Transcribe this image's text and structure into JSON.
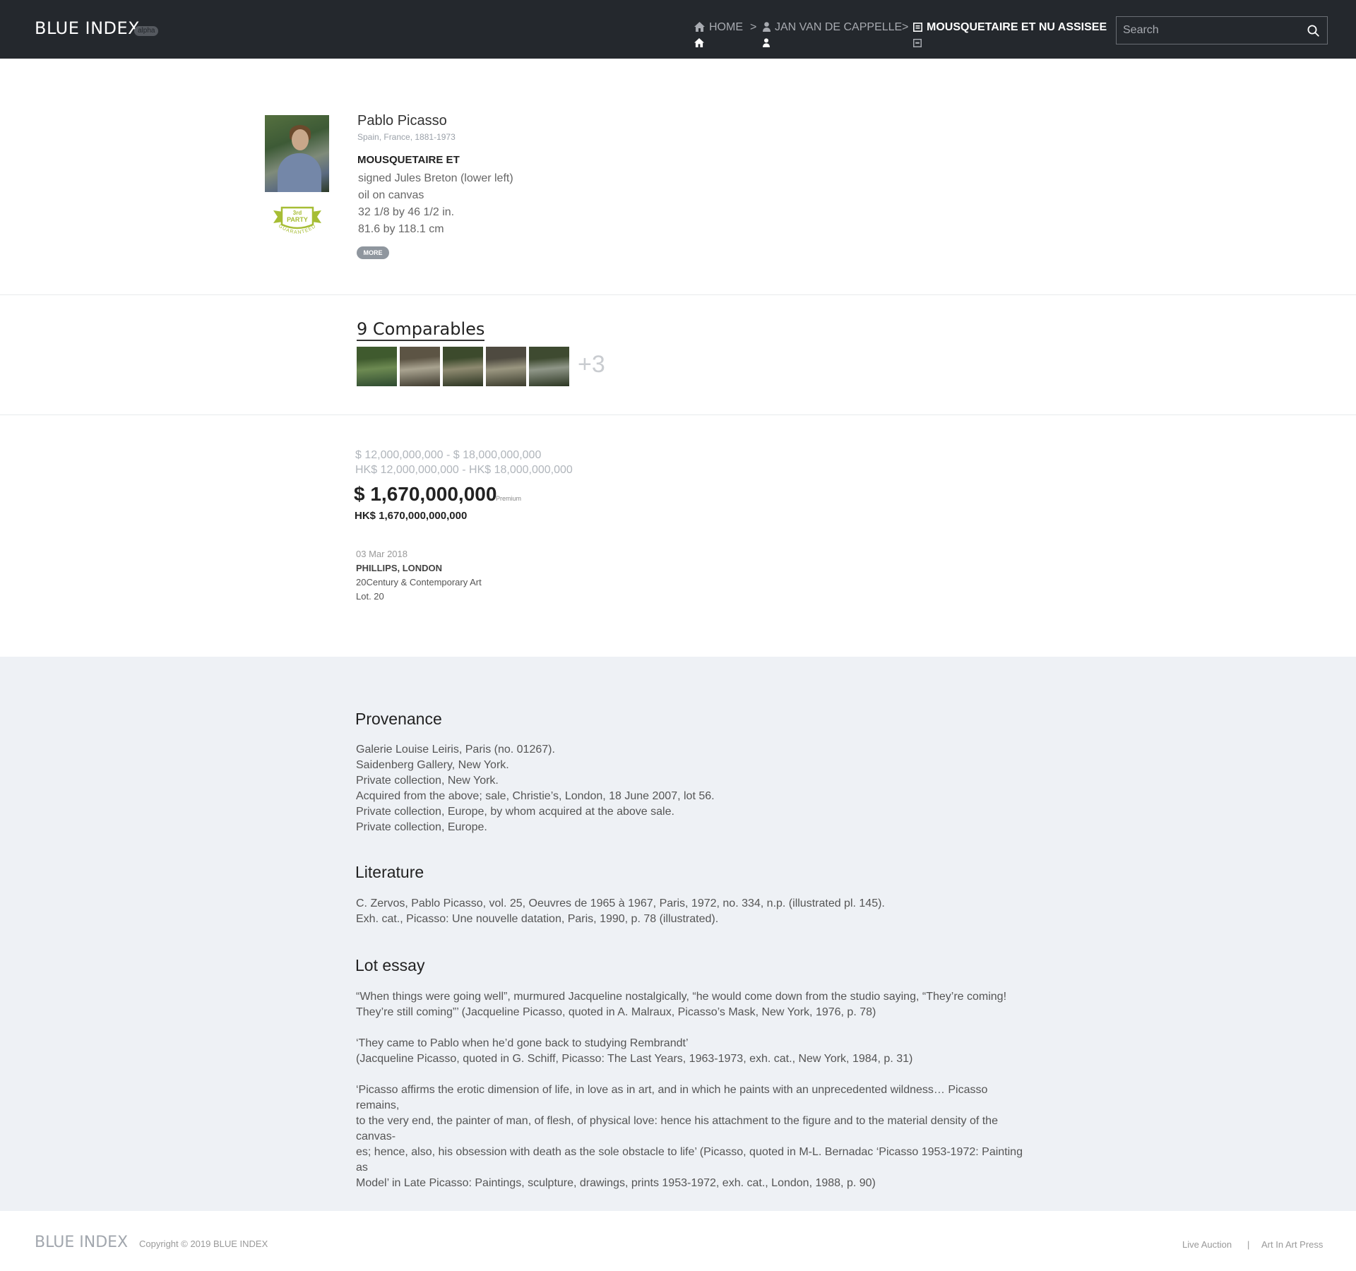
{
  "header": {
    "logo": "BLUE INDEX",
    "badge": "alpha",
    "breadcrumbs": [
      {
        "label": "HOME",
        "icon": "home-icon"
      },
      {
        "label": "JAN VAN DE CAPPELLE",
        "icon": "person-icon"
      },
      {
        "label": "MOUSQUETAIRE ET NU ASSISEE",
        "icon": "artwork-icon"
      }
    ],
    "separator": ">",
    "search_placeholder": "Search"
  },
  "artwork": {
    "artist": "Pablo Picasso",
    "lifespan": "Spain, France, 1881-1973",
    "title": "MOUSQUETAIRE ET",
    "details": [
      "signed Jules Breton (lower left)",
      "oil on canvas",
      "32 1/8 by 46 1/2 in.",
      "81.6 by 118.1 cm"
    ],
    "more_label": "MORE",
    "seal": {
      "top": "3rd",
      "middle": "PARTY",
      "bottom": "GUARANTEED",
      "color": "#a6bd34"
    }
  },
  "comparables": {
    "heading": "9 Comparables",
    "more": "+3",
    "thumbs": [
      {
        "colors": [
          "#3f5a2e",
          "#6d8a52",
          "#2e4a30"
        ]
      },
      {
        "colors": [
          "#5c5444",
          "#a9a390",
          "#3e3a2e"
        ]
      },
      {
        "colors": [
          "#3c4a2c",
          "#8e8a70",
          "#2a3320"
        ]
      },
      {
        "colors": [
          "#4e4a40",
          "#9a9680",
          "#3a3b2c"
        ]
      },
      {
        "colors": [
          "#3e4a30",
          "#8f9688",
          "#2c3622"
        ]
      }
    ]
  },
  "sale": {
    "estimate_usd": "$ 12,000,000,000 - $ 18,000,000,000",
    "estimate_hkd": "HK$ 12,000,000,000 - HK$ 18,000,000,000",
    "price_usd": "$ 1,670,000,000",
    "premium_label": "Premium",
    "price_hkd": "HK$ 1,670,000,000,000",
    "date": "03 Mar 2018",
    "house": "PHILLIPS, LONDON",
    "sale_name": "20Century & Contemporary Art",
    "lot": "Lot. 20"
  },
  "provenance": {
    "heading": "Provenance",
    "lines": [
      "Galerie Louise Leiris, Paris (no. 01267).",
      "Saidenberg Gallery, New York.",
      "Private collection, New York.",
      "Acquired from the above; sale, Christie’s, London, 18 June 2007, lot 56.",
      "Private collection, Europe, by whom acquired at the above sale.",
      "Private collection, Europe."
    ]
  },
  "literature": {
    "heading": "Literature",
    "lines": [
      "C. Zervos, Pablo Picasso, vol. 25, Oeuvres de 1965 à 1967, Paris, 1972, no. 334, n.p. (illustrated pl. 145).",
      "Exh. cat., Picasso: Une nouvelle datation, Paris, 1990, p. 78 (illustrated)."
    ]
  },
  "essay": {
    "heading": "Lot essay",
    "p1": [
      "“When things were going well”, murmured Jacqueline nostalgically, “he would come down from the studio saying, “They’re coming!",
      "They’re still coming”’ (Jacqueline Picasso, quoted in A. Malraux, Picasso’s Mask, New York, 1976, p. 78)"
    ],
    "p2": [
      "‘They came to Pablo when he’d gone back to studying Rembrandt’",
      "(Jacqueline Picasso, quoted in G. Schiff, Picasso: The Last Years, 1963-1973, exh. cat., New York, 1984, p. 31)"
    ],
    "p3": [
      "‘Picasso affirms the erotic dimension of life, in love as in art, and in which he paints with an unprecedented wildness… Picasso remains,",
      "to the very end, the painter of man, of flesh, of physical love: hence his attachment to the figure and to the material density of the canvas-",
      "es; hence, also, his obsession with death as the sole obstacle to life’ (Picasso, quoted in M-L. Bernadac ‘Picasso 1953-1972: Painting as",
      "Model’ in Late Picasso: Paintings, sculpture, drawings, prints 1953-1972, exh. cat., London, 1988, p. 90)"
    ]
  },
  "footer": {
    "logo": "BLUE INDEX",
    "copyright": "Copyright © 2019 BLUE INDEX",
    "links": [
      "Live Auction",
      "Art In Art Press"
    ],
    "divider": "|"
  }
}
